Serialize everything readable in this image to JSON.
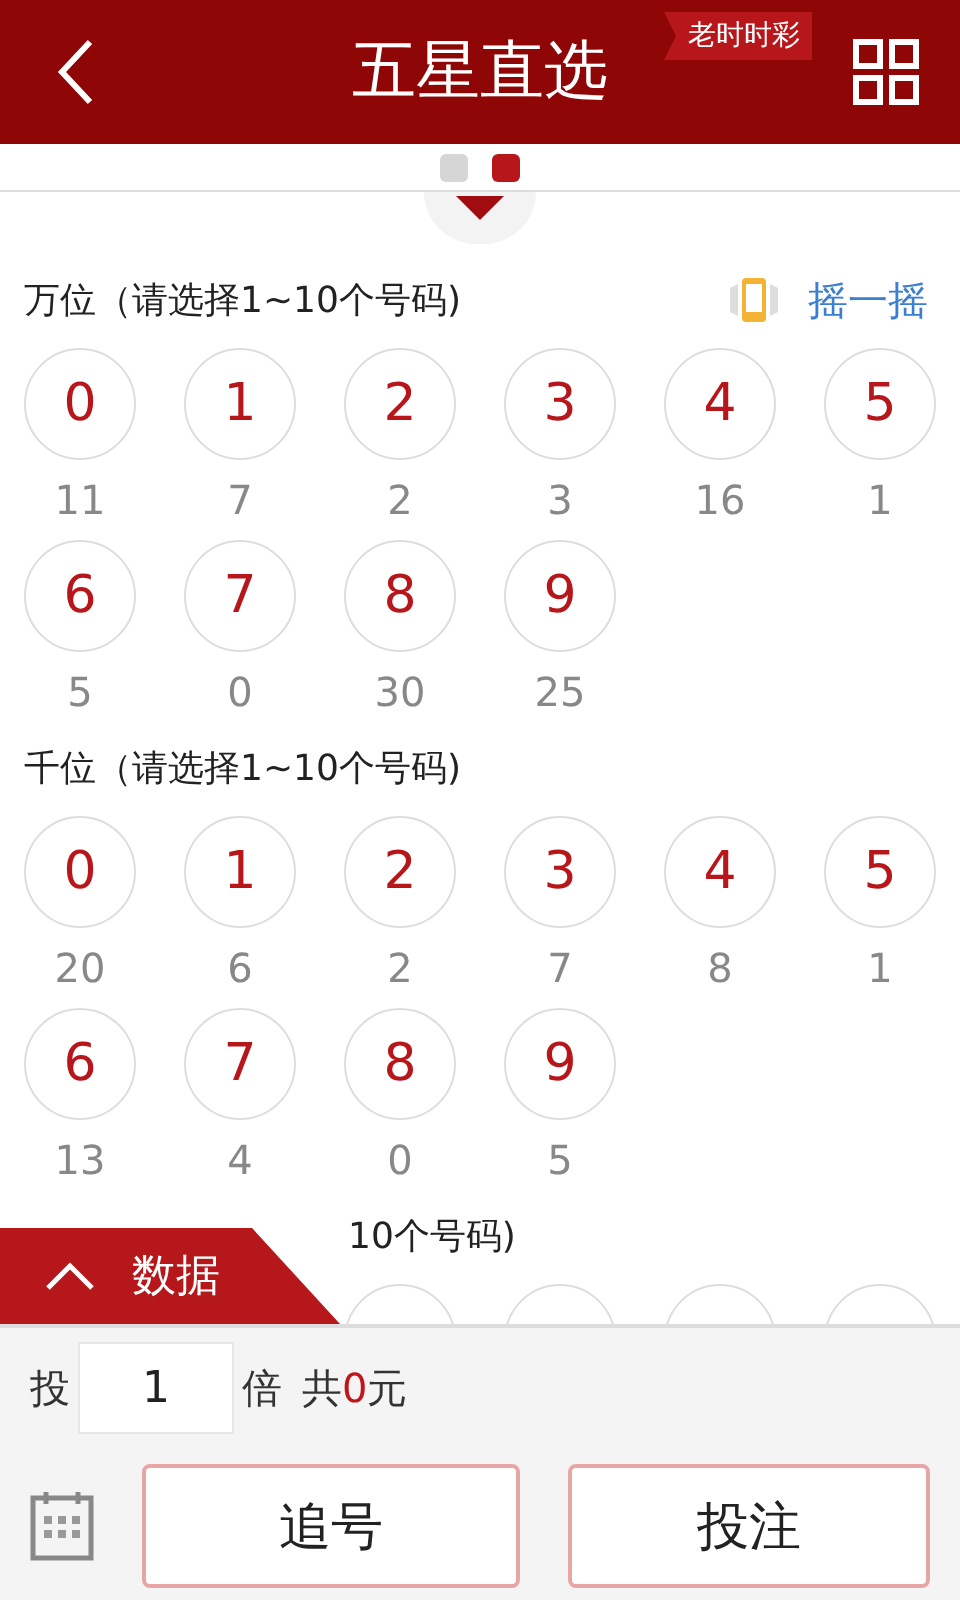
{
  "header": {
    "title": "五星直选",
    "badge": "老时时彩"
  },
  "pager": [
    {
      "selected": false
    },
    {
      "selected": true
    }
  ],
  "shake": "摇一摇",
  "sections": [
    {
      "title": "万位（请选择1~10个号码)",
      "balls": [
        {
          "number": "0",
          "count": "11",
          "selected": false
        },
        {
          "number": "1",
          "count": "7",
          "selected": false
        },
        {
          "number": "2",
          "count": "2",
          "selected": false
        },
        {
          "number": "3",
          "count": "3",
          "selected": false
        },
        {
          "number": "4",
          "count": "16",
          "selected": false
        },
        {
          "number": "5",
          "count": "1",
          "selected": false
        },
        {
          "number": "6",
          "count": "5",
          "selected": false
        },
        {
          "number": "7",
          "count": "0",
          "selected": false
        },
        {
          "number": "8",
          "count": "30",
          "selected": false
        },
        {
          "number": "9",
          "count": "25",
          "selected": false
        }
      ]
    },
    {
      "title": "千位（请选择1~10个号码)",
      "balls": [
        {
          "number": "0",
          "count": "20",
          "selected": false
        },
        {
          "number": "1",
          "count": "6",
          "selected": false
        },
        {
          "number": "2",
          "count": "2",
          "selected": false
        },
        {
          "number": "3",
          "count": "7",
          "selected": false
        },
        {
          "number": "4",
          "count": "8",
          "selected": false
        },
        {
          "number": "5",
          "count": "1",
          "selected": false
        },
        {
          "number": "6",
          "count": "13",
          "selected": false
        },
        {
          "number": "7",
          "count": "4",
          "selected": false
        },
        {
          "number": "8",
          "count": "0",
          "selected": false
        },
        {
          "number": "9",
          "count": "5",
          "selected": false
        }
      ]
    },
    {
      "title": "10个号码)"
    }
  ],
  "data_tab": "数据",
  "bet": {
    "prefix": "投",
    "multiple": "1",
    "suffix": "倍",
    "total_prefix": "共",
    "total": "0",
    "total_suffix": "元"
  },
  "buttons": [
    "追号",
    "投注"
  ]
}
